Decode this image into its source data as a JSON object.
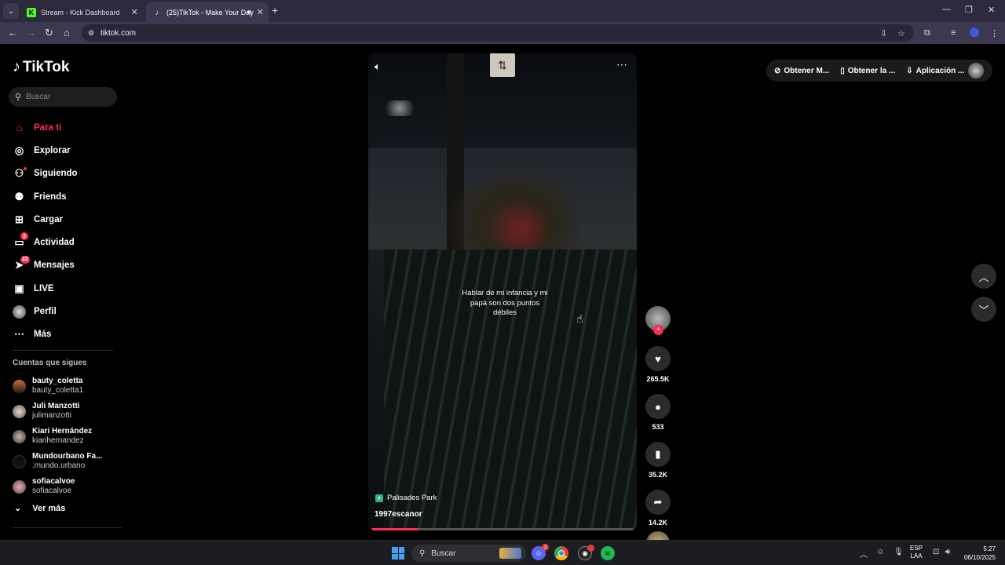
{
  "browser": {
    "tabs": [
      {
        "title": "Stream - Kick Dashboard",
        "icon": "kick-icon",
        "color": "#53fc18"
      },
      {
        "title": "(25)TikTok - Make Your Day",
        "icon": "tiktok-icon",
        "color": "#ffffff"
      }
    ],
    "url": "tiktok.com"
  },
  "sidebar": {
    "logo": "TikTok",
    "search_placeholder": "Buscar",
    "nav": [
      {
        "label": "Para ti",
        "icon": "home-icon"
      },
      {
        "label": "Explorar",
        "icon": "compass-icon"
      },
      {
        "label": "Siguiendo",
        "icon": "following-icon"
      },
      {
        "label": "Friends",
        "icon": "friends-icon"
      },
      {
        "label": "Cargar",
        "icon": "upload-icon"
      },
      {
        "label": "Actividad",
        "icon": "activity-icon",
        "badge": "3"
      },
      {
        "label": "Mensajes",
        "icon": "messages-icon",
        "badge": "22"
      },
      {
        "label": "LIVE",
        "icon": "live-icon"
      },
      {
        "label": "Perfil",
        "icon": "profile-icon"
      },
      {
        "label": "Más",
        "icon": "more-icon"
      }
    ],
    "following_title": "Cuentas que sigues",
    "following": [
      {
        "name": "bauty_coletta",
        "user": "bauty_coletta1"
      },
      {
        "name": "Juli Manzotti",
        "user": "julimanzotti"
      },
      {
        "name": "Kiari Hernández",
        "user": "kiarihernandez"
      },
      {
        "name": "Mundourbano Fa...",
        "user": ".mundo.urbano"
      },
      {
        "name": "sofiacalvoe",
        "user": "sofiacalvoe"
      }
    ],
    "see_more": "Ver más"
  },
  "video": {
    "caption": "Hablar de mi infancia y mi papá son dos puntos débiles",
    "location": "Palisades Park",
    "author": "1997escanor",
    "progress": 0.18
  },
  "actions": {
    "likes": "265.5K",
    "comments": "533",
    "saves": "35.2K",
    "shares": "14.2K"
  },
  "topbar": {
    "item1": "Obtener M...",
    "item2": "Obtener la ...",
    "item3": "Aplicación ..."
  },
  "taskbar": {
    "search": "Buscar",
    "lang1": "ESP",
    "lang2": "LAA",
    "time": "5:27",
    "date": "06/10/2025"
  },
  "colors": {
    "accent": "#fe2c55"
  }
}
